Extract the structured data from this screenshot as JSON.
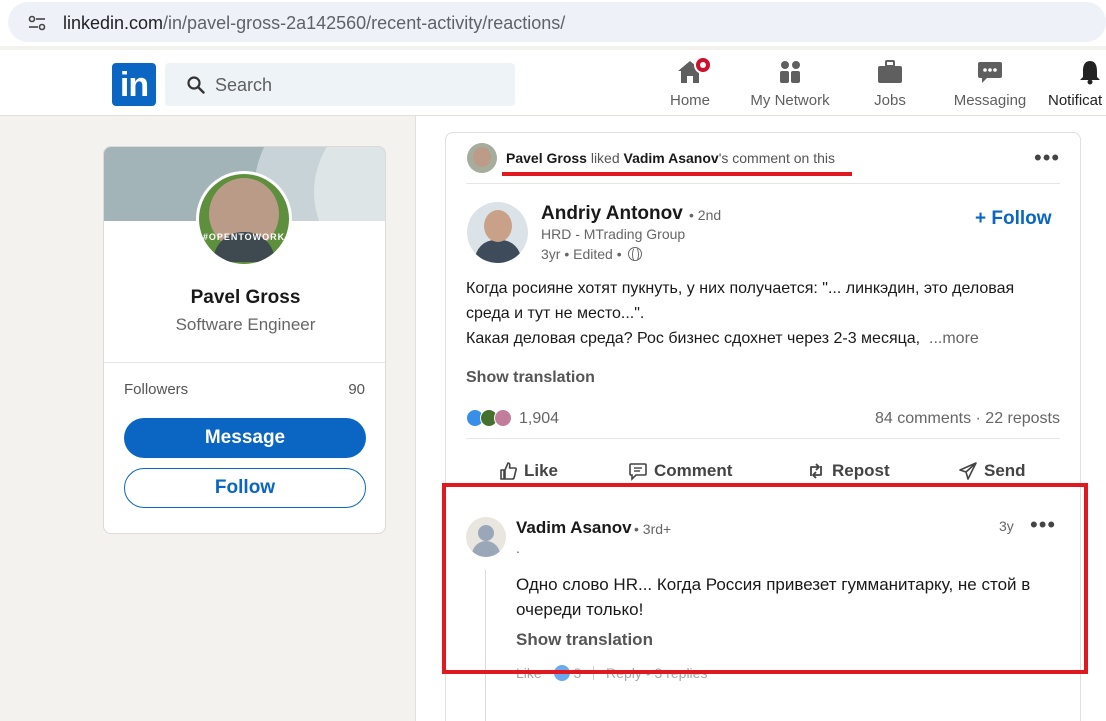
{
  "browser": {
    "url_host": "linkedin.com",
    "url_path": "/in/pavel-gross-2a142560/recent-activity/reactions/"
  },
  "nav": {
    "logo_text": "in",
    "search_placeholder": "Search",
    "items": [
      {
        "label": "Home",
        "icon": "home-icon"
      },
      {
        "label": "My Network",
        "icon": "network-icon"
      },
      {
        "label": "Jobs",
        "icon": "briefcase-icon"
      },
      {
        "label": "Messaging",
        "icon": "messaging-icon"
      },
      {
        "label": "Notificat",
        "icon": "bell-icon"
      }
    ],
    "colors": {
      "brand": "#0a66c2",
      "badge": "#cb112d"
    }
  },
  "profile": {
    "name": "Pavel Gross",
    "title": "Software Engineer",
    "avatar_badge": "#OPENTOWORK",
    "followers_label": "Followers",
    "followers_count": "90",
    "message_label": "Message",
    "follow_label": "Follow"
  },
  "activity": {
    "actor": "Pavel Gross",
    "verb": "liked",
    "target": "Vadim Asanov",
    "suffix": "'s comment on this"
  },
  "post": {
    "author_name": "Andriy Antonov",
    "author_degree": "• 2nd",
    "author_headline": "HRD - MTrading Group",
    "author_time": "3yr • Edited •",
    "follow_label": "+ Follow",
    "text_line1": "Когда росияне хотят пукнуть, у них получается: \"... линкэдин, это деловая среда и тут не место...\".",
    "text_line2": "Какая деловая среда? Рос бизнес сдохнет через 2-3 месяца,",
    "more_label": "...more",
    "show_translation": "Show translation",
    "reaction_count": "1,904",
    "stats": "84 comments · 22 reposts",
    "actions": [
      "Like",
      "Comment",
      "Repost",
      "Send"
    ]
  },
  "comment": {
    "author_name": "Vadim Asanov",
    "author_degree": "• 3rd+",
    "author_headline": ".",
    "time": "3y",
    "text": "Одно слово HR... Когда Россия привезет гумманитарку, не стой в очереди только!",
    "show_translation": "Show translation",
    "like_label": "Like",
    "like_count": "3",
    "reply_label": "Reply",
    "replies_label": "3 replies"
  },
  "highlight_color": "#e0181f"
}
